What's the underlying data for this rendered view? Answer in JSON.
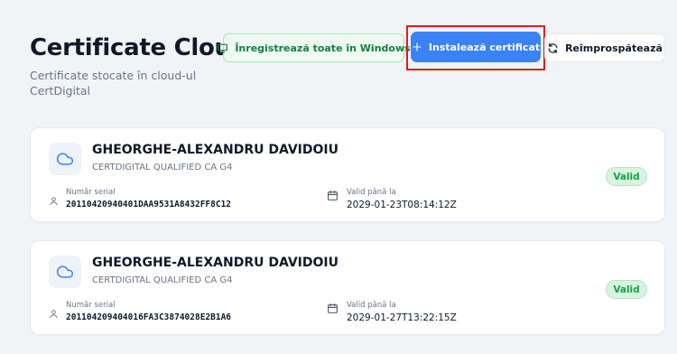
{
  "header": {
    "title": "Certificate Cloud",
    "subtitle": "Certificate stocate în cloud-ul CertDigital"
  },
  "toolbar": {
    "register_label": "Înregistrează toate în Windows",
    "install_label": "Instalează certificat",
    "refresh_label": "Reîmprospătează"
  },
  "labels": {
    "serial_label": "Număr serial",
    "valid_until_label": "Valid până la"
  },
  "certificates": [
    {
      "name": "GHEORGHE-ALEXANDRU DAVIDOIU",
      "issuer": "CERTDIGITAL QUALIFIED CA G4",
      "serial": "20110420940401DAA9531A8432FF8C12",
      "valid_until": "2029-01-23T08:14:12Z",
      "status": "Valid"
    },
    {
      "name": "GHEORGHE-ALEXANDRU DAVIDOIU",
      "issuer": "CERTDIGITAL QUALIFIED CA G4",
      "serial": "201104209404016FA3C3874028E2B1A6",
      "valid_until": "2029-01-27T13:22:15Z",
      "status": "Valid"
    }
  ],
  "icons": {
    "register": "monitor-icon",
    "install": "plus-icon",
    "refresh": "refresh-icon",
    "cert": "cloud-icon",
    "serial": "user-icon",
    "valid": "calendar-icon"
  },
  "colors": {
    "accent": "#3b82f6",
    "success": "#16a34a",
    "success_bg": "#d8f3df",
    "highlight": "#e01b1b"
  }
}
